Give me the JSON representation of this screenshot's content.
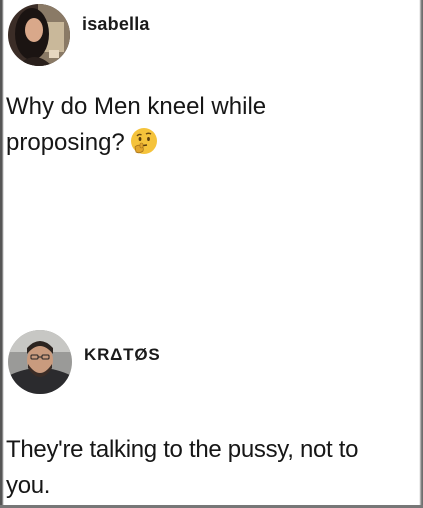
{
  "posts": [
    {
      "username": "isabella",
      "text_line1": "Why do Men kneel while",
      "text_line2": "proposing?",
      "emoji": "thinking-face-icon"
    },
    {
      "username": "KRΔTØS",
      "text_line1": "They're talking to the pussy, not to",
      "text_line2": "you."
    }
  ],
  "colors": {
    "background": "#ffffff",
    "text": "#161616",
    "emoji_yellow": "#f5c33b"
  }
}
